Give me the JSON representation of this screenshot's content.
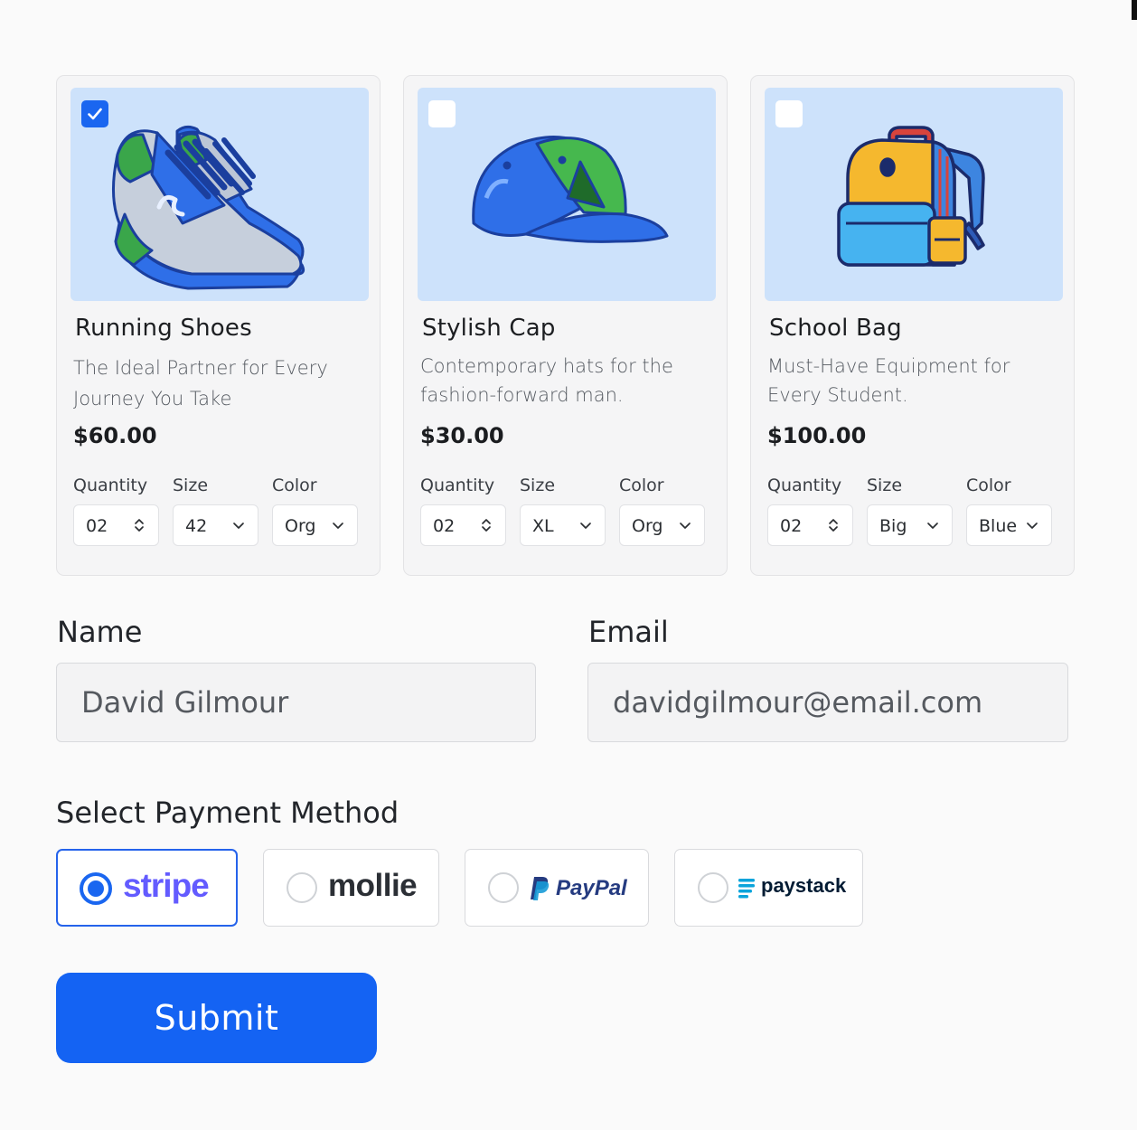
{
  "products": [
    {
      "name": "Running Shoes",
      "description": "The Ideal Partner for Every Journey You Take",
      "price": "$60.00",
      "selected": true,
      "icon": "running-shoes-illustration",
      "quantity_label": "Quantity",
      "quantity": "02",
      "size_label": "Size",
      "size": "42",
      "color_label": "Color",
      "color": "Org"
    },
    {
      "name": "Stylish Cap",
      "description": "Contemporary hats for the fashion-forward man.",
      "price": "$30.00",
      "selected": false,
      "icon": "cap-illustration",
      "quantity_label": "Quantity",
      "quantity": "02",
      "size_label": "Size",
      "size": "XL",
      "color_label": "Color",
      "color": "Org"
    },
    {
      "name": "School Bag",
      "description": "Must-Have Equipment for Every Student.",
      "price": "$100.00",
      "selected": false,
      "icon": "backpack-illustration",
      "quantity_label": "Quantity",
      "quantity": "02",
      "size_label": "Size",
      "size": "Big",
      "color_label": "Color",
      "color": "Blue"
    }
  ],
  "form": {
    "name_label": "Name",
    "name_value": "David Gilmour",
    "email_label": "Email",
    "email_value": "davidgilmour@email.com"
  },
  "payment": {
    "title": "Select Payment Method",
    "selected": "stripe",
    "options": [
      "stripe",
      "mollie",
      "PayPal",
      "paystack"
    ]
  },
  "submit_label": "Submit",
  "colors": {
    "accent": "#1463f3",
    "card_image_bg": "#cde2fb",
    "stripe": "#635bff",
    "paypal_dark": "#253b80",
    "paypal_light": "#179bd7",
    "paystack": "#0ba4db"
  }
}
